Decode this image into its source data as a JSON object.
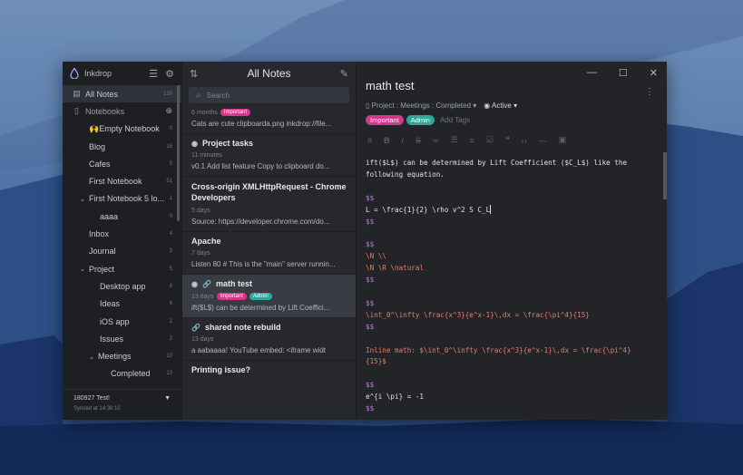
{
  "colors": {
    "accent_pink": "#d8358a",
    "accent_teal": "#2ca99a",
    "window_bg": "#222428"
  },
  "sidebar": {
    "app_name": "Inkdrop",
    "items": [
      {
        "label": "All Notes",
        "count": "139",
        "icon": "note-icon",
        "active": true
      },
      {
        "label": "Notebooks",
        "count": "",
        "icon": "book-icon"
      },
      {
        "label": "🙌Empty Notebook",
        "count": "0"
      },
      {
        "label": "Blog",
        "count": "16"
      },
      {
        "label": "Cafes",
        "count": "5"
      },
      {
        "label": "First Notebook",
        "count": "51"
      },
      {
        "label": "First Notebook 5 lo...",
        "count": "1"
      },
      {
        "label": "aaaa",
        "count": "0"
      },
      {
        "label": "Inbox",
        "count": "4"
      },
      {
        "label": "Journal",
        "count": "3"
      },
      {
        "label": "Project",
        "count": "5"
      },
      {
        "label": "Desktop app",
        "count": "8"
      },
      {
        "label": "Ideas",
        "count": "6"
      },
      {
        "label": "iOS app",
        "count": "2"
      },
      {
        "label": "Issues",
        "count": "3"
      },
      {
        "label": "Meetings",
        "count": "10"
      },
      {
        "label": "Completed",
        "count": "13"
      }
    ],
    "user": "180927 Test!",
    "sync_status": "Synced at 14:38:10"
  },
  "notelist": {
    "title": "All Notes",
    "search_placeholder": "Search",
    "notes": [
      {
        "title": "",
        "time": "6 months",
        "tags": [
          "Important"
        ],
        "body": "Cats are cute clipboarda.png inkdrop://file..."
      },
      {
        "title": "Project tasks",
        "time": "11 minutes",
        "tags": [],
        "body": "v0.1 Add list feature Copy to clipboard do..."
      },
      {
        "title": "Cross-origin XMLHttpRequest - Chrome Developers",
        "time": "5 days",
        "tags": [],
        "body": "Source: https://developer.chrome.com/do..."
      },
      {
        "title": "Apache",
        "time": "7 days",
        "tags": [],
        "body": "Listen 80 # This is the \"main\" server runnin..."
      },
      {
        "title": "math test",
        "time": "13 days",
        "tags": [
          "Important",
          "Admin"
        ],
        "body": "ift($L$) can be determined by Lift Coeffici..."
      },
      {
        "title": "shared note rebuild",
        "time": "13 days",
        "tags": [],
        "body": "a aabaaaa! YouTube embed: <iframe widt"
      },
      {
        "title": "Printing issue?",
        "time": "",
        "tags": [],
        "body": ""
      }
    ]
  },
  "editor": {
    "title": "math test",
    "breadcrumb": "Project : Meetings : Completed",
    "status": "Active",
    "tags": [
      "Important",
      "Admin"
    ],
    "add_tags": "Add Tags",
    "lines": [
      "ift($L$) can be determined by Lift Coefficient ($C_L$) like the",
      "following equation.",
      "",
      "$$",
      "L = \\frac{1}{2} \\rho v^2 S C_L",
      "$$",
      "",
      "$$",
      "\\N \\\\",
      "\\N \\R \\natural",
      "$$",
      "",
      "$$",
      "\\int_0^\\infty \\frac{x^3}{e^x-1}\\,dx = \\frac{\\pi^4}{15}",
      "$$",
      "",
      "Inline math: $\\int_0^\\infty \\frac{x^3}{e^x-1}\\,dx = \\frac{\\pi^4}",
      "{15}$",
      "",
      "$$",
      "e^{i \\pi} = -1",
      "$$"
    ]
  }
}
